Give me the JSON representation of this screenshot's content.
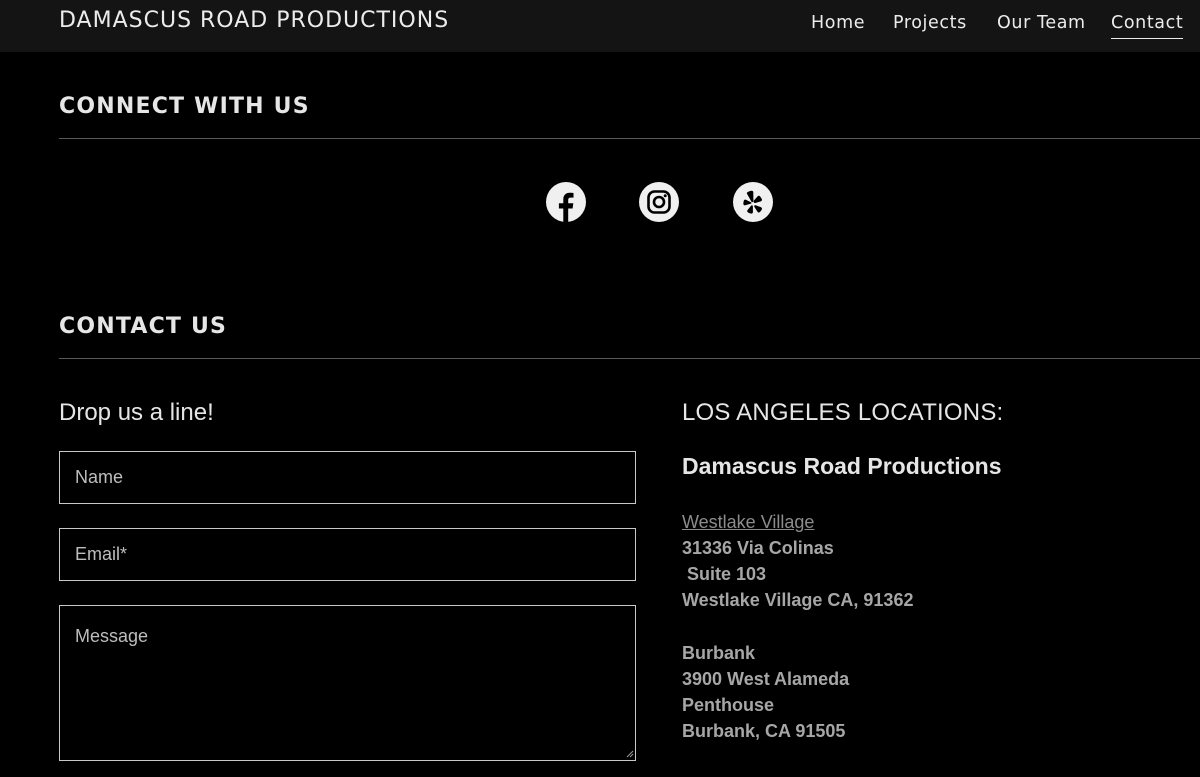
{
  "header": {
    "brand": "DAMASCUS ROAD PRODUCTIONS",
    "nav": [
      {
        "label": "Home"
      },
      {
        "label": "Projects"
      },
      {
        "label": "Our Team"
      },
      {
        "label": "Contact",
        "active": true
      }
    ]
  },
  "connect": {
    "title": "CONNECT WITH US",
    "icons": [
      "facebook-icon",
      "instagram-icon",
      "yelp-icon"
    ]
  },
  "contact": {
    "title": "CONTACT US",
    "form": {
      "heading": "Drop us a line!",
      "name_placeholder": "Name",
      "email_placeholder": "Email*",
      "message_placeholder": "Message"
    },
    "locations": {
      "heading": "LOS ANGELES LOCATIONS:",
      "company": "Damascus Road Productions",
      "westlake": {
        "link": "Westlake Village",
        "line1": "31336 Via Colinas",
        "line2": " Suite 103",
        "line3": "Westlake Village CA, 91362"
      },
      "burbank": {
        "name": "Burbank",
        "line1": "3900 West Alameda",
        "line2": "Penthouse",
        "line3": "Burbank, CA 91505"
      }
    }
  },
  "colors": {
    "background": "#000000",
    "header_bg": "#141414",
    "text": "#e6e6e6",
    "muted_text": "#a6a6a6"
  }
}
